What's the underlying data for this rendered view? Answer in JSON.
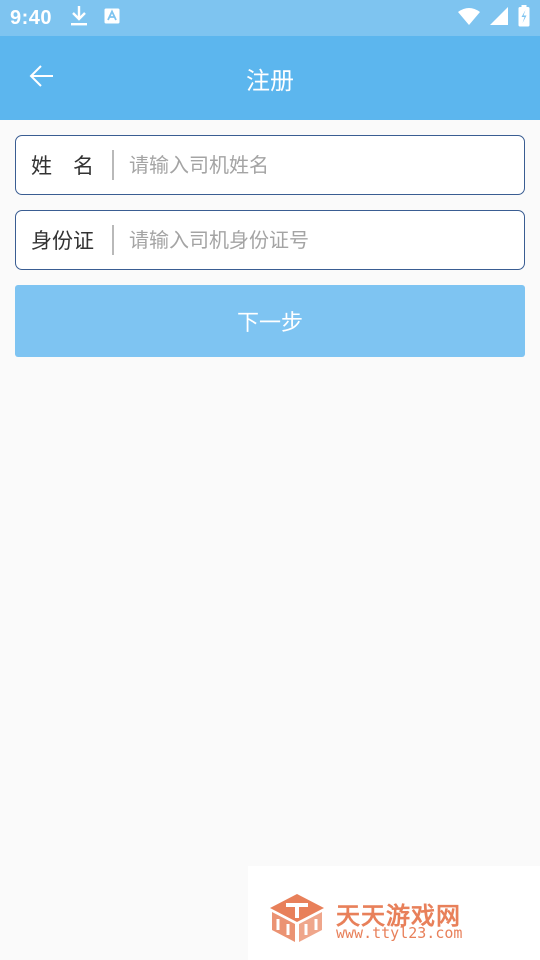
{
  "status_bar": {
    "time": "9:40",
    "icons": [
      "download-icon",
      "a-notification-icon",
      "wifi-icon",
      "signal-icon",
      "battery-icon"
    ]
  },
  "app_bar": {
    "title": "注册",
    "back_icon": "back-arrow-icon",
    "background": "#5cb6ee"
  },
  "form": {
    "name_field": {
      "label": "姓　名",
      "value": "",
      "placeholder": "请输入司机姓名"
    },
    "id_field": {
      "label": "身份证",
      "value": "",
      "placeholder": "请输入司机身份证号"
    },
    "next_button": {
      "label": "下一步",
      "color": "#7ec4f2"
    }
  },
  "watermark": {
    "name": "天天游戏网",
    "url": "www.ttyl23.com",
    "color": "#e8805a"
  }
}
